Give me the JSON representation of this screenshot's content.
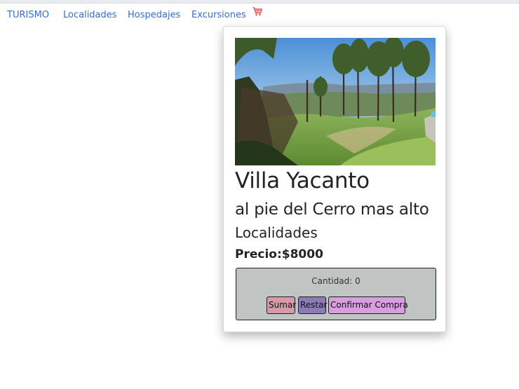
{
  "nav": {
    "brand": "TURISMO",
    "items": [
      {
        "label": "Localidades"
      },
      {
        "label": "Hospedajes"
      },
      {
        "label": "Excursiones"
      }
    ],
    "cart_icon": "shopping-cart-icon"
  },
  "card": {
    "image_icon": "landscape-photo",
    "title": "Villa Yacanto",
    "subtitle": "al pie del Cerro mas alto",
    "category": "Localidades",
    "price": "Precio:$8000",
    "counter": {
      "quantity_label": "Cantidad: 0",
      "buttons": {
        "add": "Sumar",
        "subtract": "Restar",
        "confirm": "Confirmar Compra"
      }
    }
  },
  "colors": {
    "link": "#2f6fd0",
    "add_button": "#d89aa9",
    "subtract_button": "#8d7bb8",
    "confirm_button": "#d89ee0",
    "counter_bg": "#c0c4c3"
  }
}
